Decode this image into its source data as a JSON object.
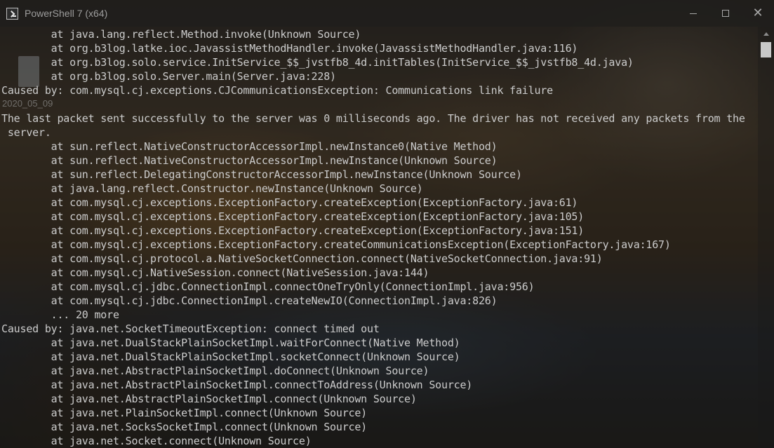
{
  "window": {
    "title": "PowerShell 7 (x64)",
    "icon": "powershell-icon"
  },
  "desktop": {
    "date_label": "2020_05_09"
  },
  "terminal": {
    "lines": [
      "        at java.lang.reflect.Method.invoke(Unknown Source)",
      "        at org.b3log.latke.ioc.JavassistMethodHandler.invoke(JavassistMethodHandler.java:116)",
      "        at org.b3log.solo.service.InitService_$$_jvstfb8_4d.initTables(InitService_$$_jvstfb8_4d.java)",
      "        at org.b3log.solo.Server.main(Server.java:228)",
      "Caused by: com.mysql.cj.exceptions.CJCommunicationsException: Communications link failure",
      "",
      "The last packet sent successfully to the server was 0 milliseconds ago. The driver has not received any packets from the",
      " server.",
      "        at sun.reflect.NativeConstructorAccessorImpl.newInstance0(Native Method)",
      "        at sun.reflect.NativeConstructorAccessorImpl.newInstance(Unknown Source)",
      "        at sun.reflect.DelegatingConstructorAccessorImpl.newInstance(Unknown Source)",
      "        at java.lang.reflect.Constructor.newInstance(Unknown Source)",
      "        at com.mysql.cj.exceptions.ExceptionFactory.createException(ExceptionFactory.java:61)",
      "        at com.mysql.cj.exceptions.ExceptionFactory.createException(ExceptionFactory.java:105)",
      "        at com.mysql.cj.exceptions.ExceptionFactory.createException(ExceptionFactory.java:151)",
      "        at com.mysql.cj.exceptions.ExceptionFactory.createCommunicationsException(ExceptionFactory.java:167)",
      "        at com.mysql.cj.protocol.a.NativeSocketConnection.connect(NativeSocketConnection.java:91)",
      "        at com.mysql.cj.NativeSession.connect(NativeSession.java:144)",
      "        at com.mysql.cj.jdbc.ConnectionImpl.connectOneTryOnly(ConnectionImpl.java:956)",
      "        at com.mysql.cj.jdbc.ConnectionImpl.createNewIO(ConnectionImpl.java:826)",
      "        ... 20 more",
      "Caused by: java.net.SocketTimeoutException: connect timed out",
      "        at java.net.DualStackPlainSocketImpl.waitForConnect(Native Method)",
      "        at java.net.DualStackPlainSocketImpl.socketConnect(Unknown Source)",
      "        at java.net.AbstractPlainSocketImpl.doConnect(Unknown Source)",
      "        at java.net.AbstractPlainSocketImpl.connectToAddress(Unknown Source)",
      "        at java.net.AbstractPlainSocketImpl.connect(Unknown Source)",
      "        at java.net.PlainSocketImpl.connect(Unknown Source)",
      "        at java.net.SocksSocketImpl.connect(Unknown Source)",
      "        at java.net.Socket.connect(Unknown Source)"
    ]
  }
}
